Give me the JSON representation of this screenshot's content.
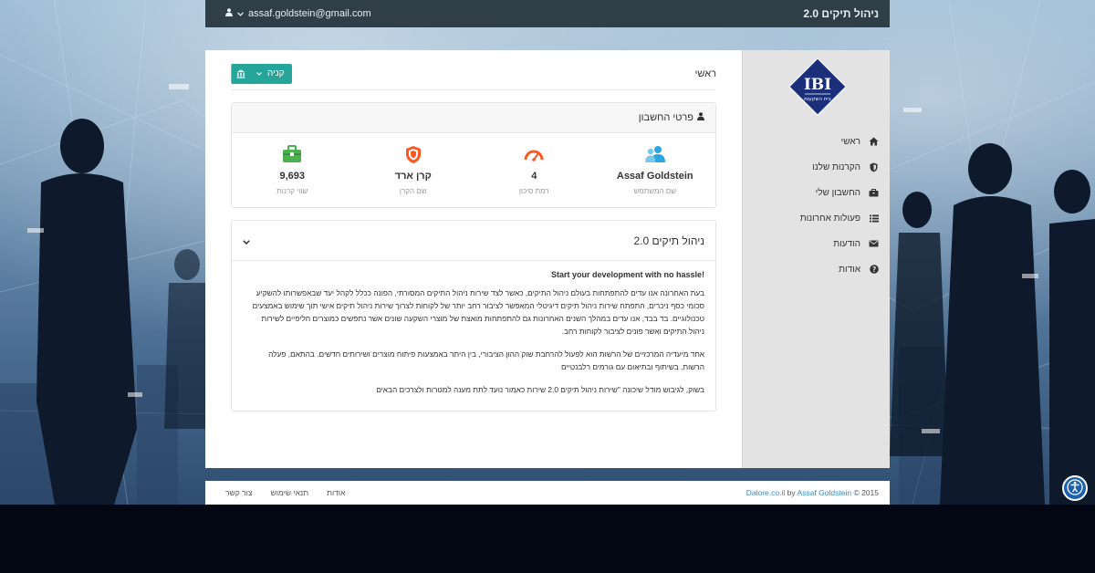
{
  "topbar": {
    "user_email": "assaf.goldstein@gmail.com",
    "brand": "ניהול תיקים 2.0"
  },
  "sidebar": {
    "logo_text": "IBI",
    "logo_subtext": "בית השקעות",
    "items": [
      {
        "label": "ראשי",
        "icon": "home-icon"
      },
      {
        "label": "הקרנות שלנו",
        "icon": "shield-icon"
      },
      {
        "label": "החשבון שלי",
        "icon": "briefcase-icon"
      },
      {
        "label": "פעולות אחרונות",
        "icon": "list-icon"
      },
      {
        "label": "הודעות",
        "icon": "envelope-icon"
      },
      {
        "label": "אודות",
        "icon": "question-icon"
      }
    ]
  },
  "main": {
    "breadcrumb": "ראשי",
    "buy_button": "קניה",
    "account_card": {
      "title": "פרטי החשבון",
      "stats": [
        {
          "value": "9,693",
          "label": "שווי קרנות",
          "icon": "wallet-icon",
          "color": "#4caf50"
        },
        {
          "value": "קרן ארד",
          "label": "שם הקרן",
          "icon": "shield-badge-icon",
          "color": "#ff5722"
        },
        {
          "value": "4",
          "label": "רמת סיכון",
          "icon": "gauge-icon",
          "color": "#ff5722"
        },
        {
          "value": "Assaf Goldstein",
          "label": "שם המשתמש",
          "icon": "users-icon",
          "color": "#29a8e0"
        }
      ]
    },
    "info_card": {
      "title": "ניהול תיקים 2.0",
      "heading": "Start your development with no hassle!",
      "p1": "בעת האחרונה אנו עדים להתפתחות בעולם ניהול התיקים, כאשר לצד שירות ניהול התיקים המסורתי, הפונה ככלל לקהל יעד שבאפשרותו להשקיע סכומי כסף ניכרים, התפתח שירות ניהול תיקים דיגיטלי המאפשר לציבור רחב יותר של לקוחות לצרוך שירות ניהול תיקים אישי תוך שימוש באמצעים טכנולוגיים. בד בבד, אנו עדים במהלך השנים האחרונות גם להתפתחות מואצת של מוצרי השקעה שונים אשר נתפשים כמוצרים חליפיים לשירות ניהול התיקים ואשר פונים לציבור לקוחות רחב.",
      "p2": "אחד מיעדיה המרכזיים של הרשות הוא לפעול להרחבת שוק ההון הציבורי, בין היתר באמצעות פיתוח מוצרים ושירותים חדשים. בהתאם, פעלה הרשות, בשיתוף ובתיאום עם גורמים רלבנטיים",
      "p3": "בשוק, לגיבוש מודל שיכונה \"שירות ניהול תיקים 2.0 שירות כאמור נועד לתת מענה למטרות ולצרכים הבאים"
    }
  },
  "footer": {
    "copyright_prefix": "© 2015",
    "author": "Assaf Goldstein",
    "by": "by",
    "site": "Dalore.co.il",
    "links": [
      "אודות",
      "תנאי שימוש",
      "צור קשר"
    ]
  },
  "colors": {
    "accent": "#26a69a",
    "topbar": "#2f3e47",
    "sidebar": "#e3e3e3",
    "link": "#3a8bc9"
  }
}
